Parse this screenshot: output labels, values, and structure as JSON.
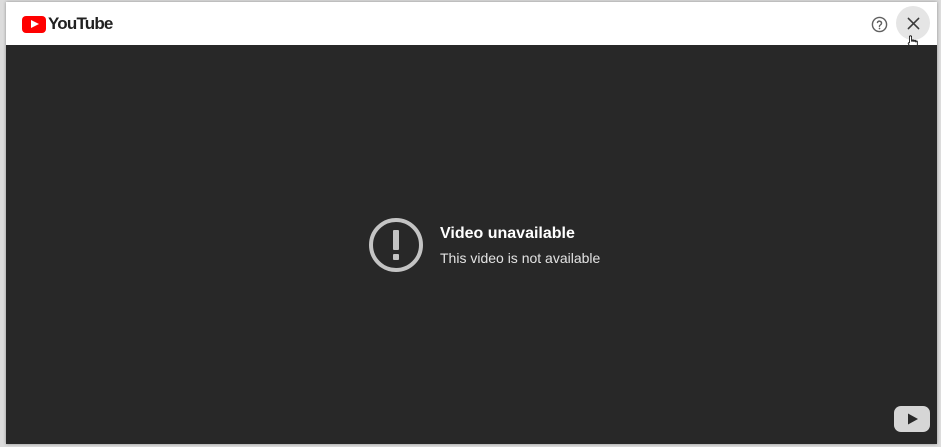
{
  "header": {
    "logo_text": "YouTube",
    "help_icon": "help-circle-icon",
    "close_icon": "close-icon"
  },
  "player": {
    "error_icon": "alert-circle-icon",
    "error_title": "Video unavailable",
    "error_subtitle": "This video is not available",
    "watermark_icon": "youtube-play-icon"
  },
  "colors": {
    "brand_red": "#ff0000",
    "player_bg": "#282828",
    "error_icon": "#c4c4c4"
  }
}
